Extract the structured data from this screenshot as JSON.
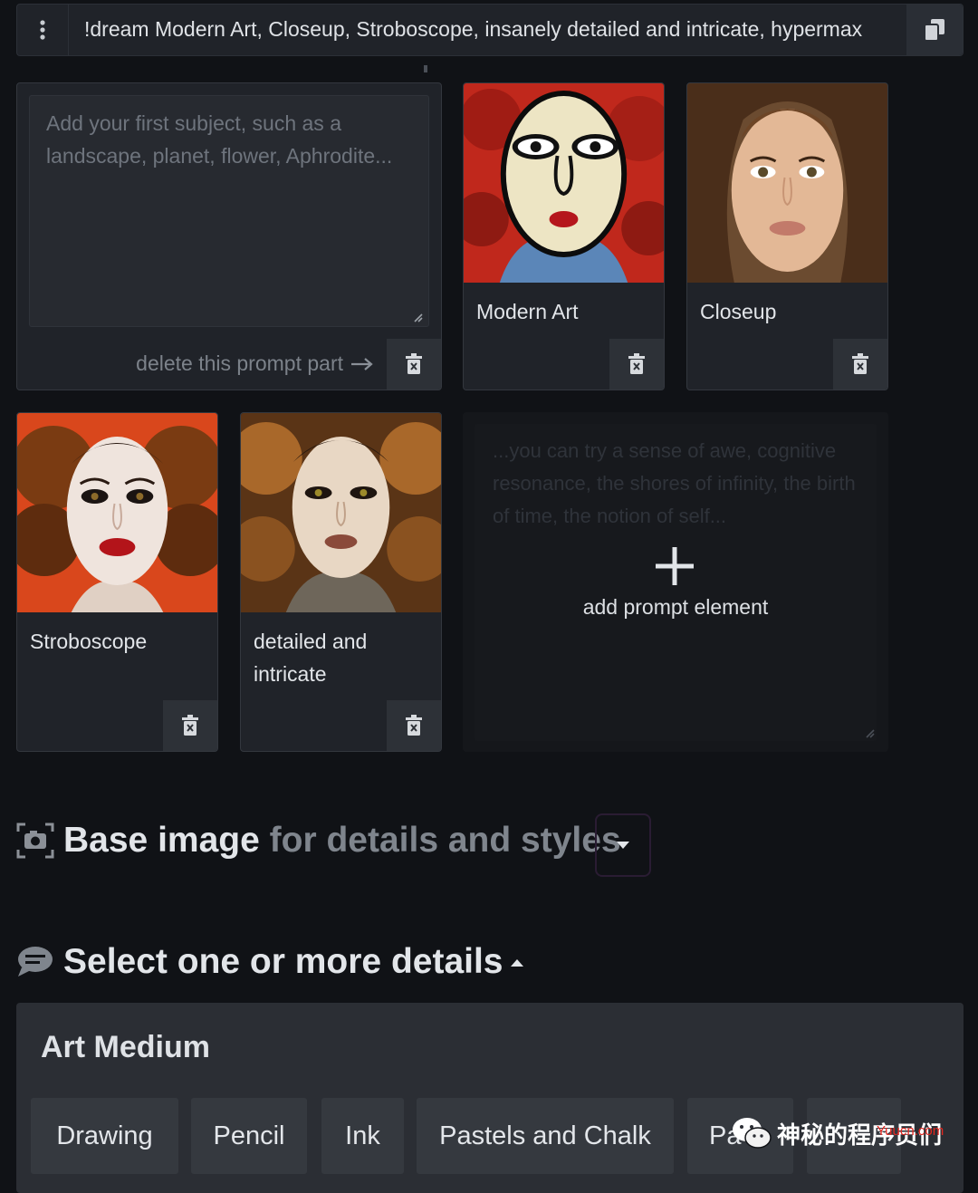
{
  "prompt_bar": {
    "text": "!dream Modern Art, Closeup, Stroboscope, insanely detailed and intricate, hypermax"
  },
  "subject_input": {
    "placeholder": "Add your first subject, such as a landscape, planet, flower, Aphrodite...",
    "delete_label": "delete this prompt part"
  },
  "prompt_cards": [
    {
      "label": "Modern Art"
    },
    {
      "label": "Closeup"
    },
    {
      "label": "Stroboscope"
    },
    {
      "label": "detailed and intricate"
    }
  ],
  "add_element": {
    "placeholder": "...you can try a sense of awe, cognitive resonance, the shores of infinity, the birth of time, the notion of self...",
    "label": "add prompt element"
  },
  "base_image": {
    "title": "Base image",
    "subtitle": "for details and styles"
  },
  "details": {
    "title": "Select one or more details"
  },
  "art_medium": {
    "title": "Art Medium",
    "chips": [
      "Drawing",
      "Pencil",
      "Ink",
      "Pastels and Chalk",
      "Pa",
      ""
    ]
  },
  "watermark": {
    "text": "神秘的程序员们",
    "url": "Yuucn.com"
  },
  "colors": {
    "background": "#101216",
    "card": "#202329",
    "panel": "#2b2e34",
    "chip": "#35393f",
    "watermark_url": "#e5261f"
  }
}
